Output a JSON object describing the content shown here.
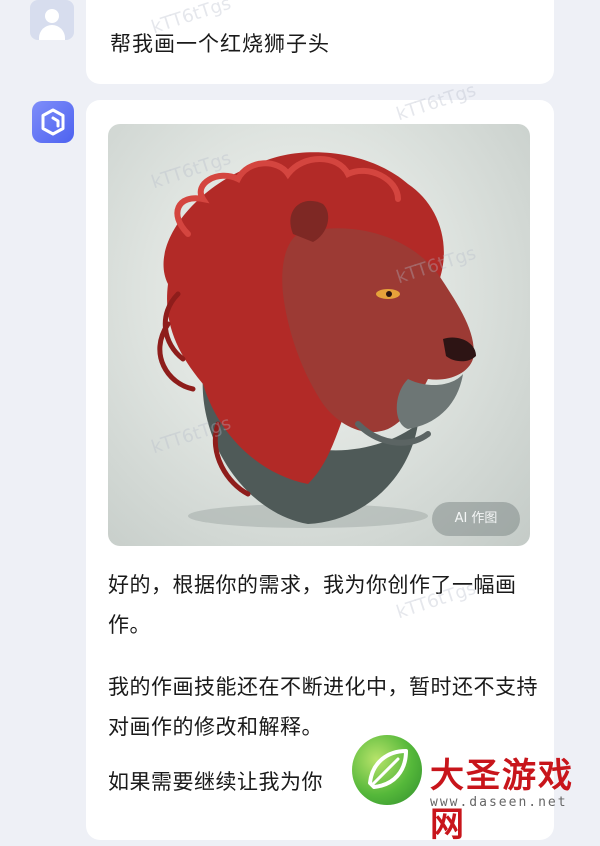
{
  "chat": {
    "user_message": "帮我画一个红烧狮子头",
    "image_badge": "AI 作图",
    "reply_paragraphs": [
      "好的，根据你的需求，我为你创作了一幅画作。",
      "我的作画技能还在不断进化中，暂时还不支持对画作的修改和解释。",
      "如果需要继续让我为你"
    ]
  },
  "watermark": "kTT6tTgs",
  "brand": {
    "name": "大圣游戏网",
    "url": "www.daseen.net"
  },
  "colors": {
    "background": "#eef0f6",
    "bubble": "#ffffff",
    "ai_avatar": "#5b6cf3",
    "brand_red": "#c8151b",
    "brand_green": "#55b83a"
  },
  "icons": {
    "user_avatar": "user-silhouette-icon",
    "ai_avatar": "cube-icon"
  },
  "image": {
    "subject": "red-maned lion head artwork"
  }
}
